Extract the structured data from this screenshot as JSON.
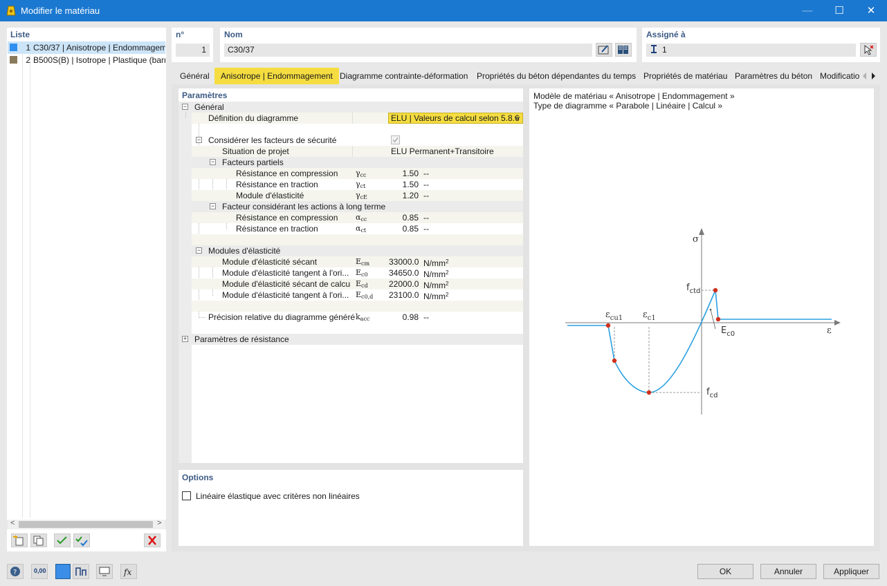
{
  "window": {
    "title": "Modifier le matériau",
    "min_glyph": "—",
    "max_glyph": "☐",
    "close_glyph": "✕"
  },
  "list": {
    "title": "Liste",
    "items": [
      {
        "num": "1",
        "label": "C30/37 | Anisotrope | Endommagement",
        "color": "#2f8ff0",
        "selected": true
      },
      {
        "num": "2",
        "label": "B500S(B) | Isotrope | Plastique (barres)",
        "color": "#8a7a5c",
        "selected": false
      }
    ],
    "scroll_left": "<",
    "scroll_right": ">"
  },
  "header": {
    "no_label": "n°",
    "no_value": "1",
    "name_label": "Nom",
    "name_value": "C30/37",
    "assigned_label": "Assigné à",
    "assigned_value": "1"
  },
  "tabs": [
    {
      "label": "Général",
      "active": false
    },
    {
      "label": "Anisotrope | Endommagement",
      "active": true
    },
    {
      "label": "Diagramme contrainte-déformation",
      "active": false
    },
    {
      "label": "Propriétés du béton dépendantes du temps",
      "active": false
    },
    {
      "label": "Propriétés de matériau",
      "active": false
    },
    {
      "label": "Paramètres du béton",
      "active": false
    },
    {
      "label": "Modificatio",
      "active": false
    }
  ],
  "params": {
    "title": "Paramètres",
    "general": "Général",
    "diag_def_label": "Définition du diagramme",
    "diag_def_value": "ELU | Valeurs de calcul selon 5.8.6",
    "safety_label": "Considérer les facteurs de sécurité",
    "situation_label": "Situation de projet",
    "situation_value": "ELU Permanent+Transitoire",
    "partial_label": "Facteurs partiels",
    "rc_label": "Résistance en compression",
    "rc_sym": "γ",
    "rc_sub": "cc",
    "rc_val": "1.50",
    "rc_unit": "--",
    "rt_label": "Résistance en traction",
    "rt_sym": "γ",
    "rt_sub": "ct",
    "rt_val": "1.50",
    "rt_unit": "--",
    "me_label": "Module d'élasticité",
    "me_sym": "γ",
    "me_sub": "cE",
    "me_val": "1.20",
    "me_unit": "--",
    "long_label": "Facteur considérant les actions à long terme",
    "lc_label": "Résistance en compression",
    "lc_sym": "α",
    "lc_sub": "cc",
    "lc_val": "0.85",
    "lc_unit": "--",
    "lt_label": "Résistance en traction",
    "lt_sym": "α",
    "lt_sub": "ct",
    "lt_val": "0.85",
    "lt_unit": "--",
    "mod_label": "Modules d'élasticité",
    "m1_label": "Module d'élasticité sécant",
    "m1_sym": "E",
    "m1_sub": "cm",
    "m1_val": "33000.0",
    "m1_unit": "N/mm",
    "m1_exp": "2",
    "m2_label": "Module d'élasticité tangent à l'ori...",
    "m2_sym": "E",
    "m2_sub": "c0",
    "m2_val": "34650.0",
    "m2_unit": "N/mm",
    "m2_exp": "2",
    "m3_label": "Module d'élasticité sécant de calcul",
    "m3_sym": "E",
    "m3_sub": "cd",
    "m3_val": "22000.0",
    "m3_unit": "N/mm",
    "m3_exp": "2",
    "m4_label": "Module d'élasticité tangent à l'ori...",
    "m4_sym": "E",
    "m4_sub": "c0,d",
    "m4_val": "23100.0",
    "m4_unit": "N/mm",
    "m4_exp": "2",
    "prec_label": "Précision relative du diagramme généré",
    "prec_sym": "k",
    "prec_sub": "acc",
    "prec_val": "0.98",
    "prec_unit": "--",
    "res_label": "Paramètres de résistance"
  },
  "options": {
    "title": "Options",
    "linear_label": "Linéaire élastique avec critères non linéaires",
    "linear_checked": false
  },
  "diagram": {
    "model_line": "Modèle de matériau « Anisotrope | Endommagement »",
    "type_line": "Type de diagramme « Parabole | Linéaire | Calcul »",
    "sigma": "σ",
    "eps": "ε",
    "fctd_main": "f",
    "fctd_sub": "ctd",
    "fcd_main": "f",
    "fcd_sub": "cd",
    "ec0_main": "E",
    "ec0_sub": "c0",
    "ecu1_main": "ε",
    "ecu1_sub": "cu1",
    "ec1_main": "ε",
    "ec1_sub": "c1",
    "curve_color": "#2aa0e0",
    "point_color": "#d0301c"
  },
  "footer": {
    "ok": "OK",
    "cancel": "Annuler",
    "apply": "Appliquer",
    "units_icon_text": "0,00"
  }
}
